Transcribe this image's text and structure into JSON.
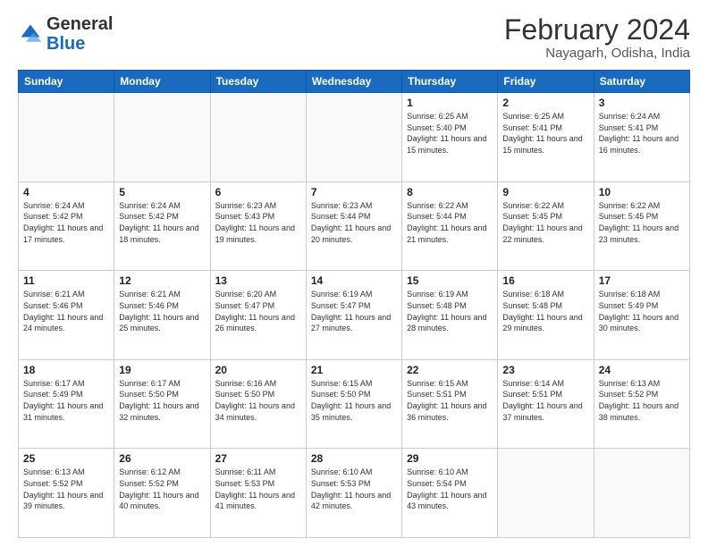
{
  "header": {
    "logo_general": "General",
    "logo_blue": "Blue",
    "month_title": "February 2024",
    "location": "Nayagarh, Odisha, India"
  },
  "weekdays": [
    "Sunday",
    "Monday",
    "Tuesday",
    "Wednesday",
    "Thursday",
    "Friday",
    "Saturday"
  ],
  "weeks": [
    [
      {
        "day": "",
        "sunrise": "",
        "sunset": "",
        "daylight": ""
      },
      {
        "day": "",
        "sunrise": "",
        "sunset": "",
        "daylight": ""
      },
      {
        "day": "",
        "sunrise": "",
        "sunset": "",
        "daylight": ""
      },
      {
        "day": "",
        "sunrise": "",
        "sunset": "",
        "daylight": ""
      },
      {
        "day": "1",
        "sunrise": "Sunrise: 6:25 AM",
        "sunset": "Sunset: 5:40 PM",
        "daylight": "Daylight: 11 hours and 15 minutes."
      },
      {
        "day": "2",
        "sunrise": "Sunrise: 6:25 AM",
        "sunset": "Sunset: 5:41 PM",
        "daylight": "Daylight: 11 hours and 15 minutes."
      },
      {
        "day": "3",
        "sunrise": "Sunrise: 6:24 AM",
        "sunset": "Sunset: 5:41 PM",
        "daylight": "Daylight: 11 hours and 16 minutes."
      }
    ],
    [
      {
        "day": "4",
        "sunrise": "Sunrise: 6:24 AM",
        "sunset": "Sunset: 5:42 PM",
        "daylight": "Daylight: 11 hours and 17 minutes."
      },
      {
        "day": "5",
        "sunrise": "Sunrise: 6:24 AM",
        "sunset": "Sunset: 5:42 PM",
        "daylight": "Daylight: 11 hours and 18 minutes."
      },
      {
        "day": "6",
        "sunrise": "Sunrise: 6:23 AM",
        "sunset": "Sunset: 5:43 PM",
        "daylight": "Daylight: 11 hours and 19 minutes."
      },
      {
        "day": "7",
        "sunrise": "Sunrise: 6:23 AM",
        "sunset": "Sunset: 5:44 PM",
        "daylight": "Daylight: 11 hours and 20 minutes."
      },
      {
        "day": "8",
        "sunrise": "Sunrise: 6:22 AM",
        "sunset": "Sunset: 5:44 PM",
        "daylight": "Daylight: 11 hours and 21 minutes."
      },
      {
        "day": "9",
        "sunrise": "Sunrise: 6:22 AM",
        "sunset": "Sunset: 5:45 PM",
        "daylight": "Daylight: 11 hours and 22 minutes."
      },
      {
        "day": "10",
        "sunrise": "Sunrise: 6:22 AM",
        "sunset": "Sunset: 5:45 PM",
        "daylight": "Daylight: 11 hours and 23 minutes."
      }
    ],
    [
      {
        "day": "11",
        "sunrise": "Sunrise: 6:21 AM",
        "sunset": "Sunset: 5:46 PM",
        "daylight": "Daylight: 11 hours and 24 minutes."
      },
      {
        "day": "12",
        "sunrise": "Sunrise: 6:21 AM",
        "sunset": "Sunset: 5:46 PM",
        "daylight": "Daylight: 11 hours and 25 minutes."
      },
      {
        "day": "13",
        "sunrise": "Sunrise: 6:20 AM",
        "sunset": "Sunset: 5:47 PM",
        "daylight": "Daylight: 11 hours and 26 minutes."
      },
      {
        "day": "14",
        "sunrise": "Sunrise: 6:19 AM",
        "sunset": "Sunset: 5:47 PM",
        "daylight": "Daylight: 11 hours and 27 minutes."
      },
      {
        "day": "15",
        "sunrise": "Sunrise: 6:19 AM",
        "sunset": "Sunset: 5:48 PM",
        "daylight": "Daylight: 11 hours and 28 minutes."
      },
      {
        "day": "16",
        "sunrise": "Sunrise: 6:18 AM",
        "sunset": "Sunset: 5:48 PM",
        "daylight": "Daylight: 11 hours and 29 minutes."
      },
      {
        "day": "17",
        "sunrise": "Sunrise: 6:18 AM",
        "sunset": "Sunset: 5:49 PM",
        "daylight": "Daylight: 11 hours and 30 minutes."
      }
    ],
    [
      {
        "day": "18",
        "sunrise": "Sunrise: 6:17 AM",
        "sunset": "Sunset: 5:49 PM",
        "daylight": "Daylight: 11 hours and 31 minutes."
      },
      {
        "day": "19",
        "sunrise": "Sunrise: 6:17 AM",
        "sunset": "Sunset: 5:50 PM",
        "daylight": "Daylight: 11 hours and 32 minutes."
      },
      {
        "day": "20",
        "sunrise": "Sunrise: 6:16 AM",
        "sunset": "Sunset: 5:50 PM",
        "daylight": "Daylight: 11 hours and 34 minutes."
      },
      {
        "day": "21",
        "sunrise": "Sunrise: 6:15 AM",
        "sunset": "Sunset: 5:50 PM",
        "daylight": "Daylight: 11 hours and 35 minutes."
      },
      {
        "day": "22",
        "sunrise": "Sunrise: 6:15 AM",
        "sunset": "Sunset: 5:51 PM",
        "daylight": "Daylight: 11 hours and 36 minutes."
      },
      {
        "day": "23",
        "sunrise": "Sunrise: 6:14 AM",
        "sunset": "Sunset: 5:51 PM",
        "daylight": "Daylight: 11 hours and 37 minutes."
      },
      {
        "day": "24",
        "sunrise": "Sunrise: 6:13 AM",
        "sunset": "Sunset: 5:52 PM",
        "daylight": "Daylight: 11 hours and 38 minutes."
      }
    ],
    [
      {
        "day": "25",
        "sunrise": "Sunrise: 6:13 AM",
        "sunset": "Sunset: 5:52 PM",
        "daylight": "Daylight: 11 hours and 39 minutes."
      },
      {
        "day": "26",
        "sunrise": "Sunrise: 6:12 AM",
        "sunset": "Sunset: 5:52 PM",
        "daylight": "Daylight: 11 hours and 40 minutes."
      },
      {
        "day": "27",
        "sunrise": "Sunrise: 6:11 AM",
        "sunset": "Sunset: 5:53 PM",
        "daylight": "Daylight: 11 hours and 41 minutes."
      },
      {
        "day": "28",
        "sunrise": "Sunrise: 6:10 AM",
        "sunset": "Sunset: 5:53 PM",
        "daylight": "Daylight: 11 hours and 42 minutes."
      },
      {
        "day": "29",
        "sunrise": "Sunrise: 6:10 AM",
        "sunset": "Sunset: 5:54 PM",
        "daylight": "Daylight: 11 hours and 43 minutes."
      },
      {
        "day": "",
        "sunrise": "",
        "sunset": "",
        "daylight": ""
      },
      {
        "day": "",
        "sunrise": "",
        "sunset": "",
        "daylight": ""
      }
    ]
  ]
}
